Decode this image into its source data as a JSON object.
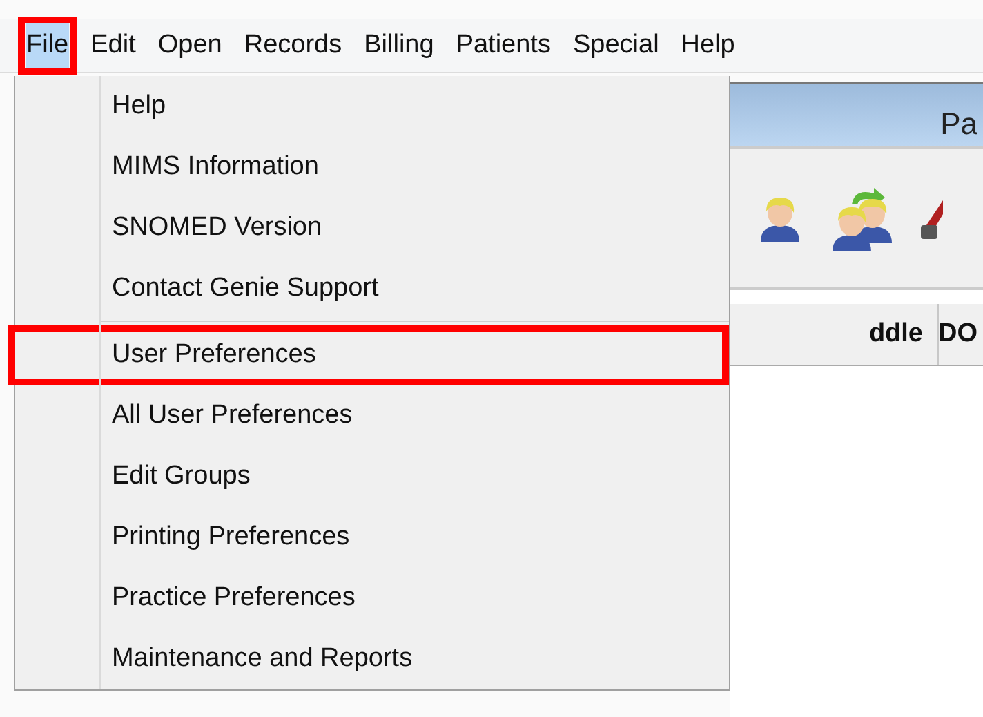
{
  "menu_bar": [
    {
      "label": "File",
      "selected": true,
      "annotated": true
    },
    {
      "label": "Edit",
      "selected": false,
      "annotated": false
    },
    {
      "label": "Open",
      "selected": false,
      "annotated": false
    },
    {
      "label": "Records",
      "selected": false,
      "annotated": false
    },
    {
      "label": "Billing",
      "selected": false,
      "annotated": false
    },
    {
      "label": "Patients",
      "selected": false,
      "annotated": false
    },
    {
      "label": "Special",
      "selected": false,
      "annotated": false
    },
    {
      "label": "Help",
      "selected": false,
      "annotated": false
    }
  ],
  "file_menu": [
    {
      "kind": "item",
      "label": "Help",
      "annotated": false
    },
    {
      "kind": "item",
      "label": "MIMS Information",
      "annotated": false
    },
    {
      "kind": "item",
      "label": "SNOMED Version",
      "annotated": false
    },
    {
      "kind": "item",
      "label": "Contact Genie Support",
      "annotated": false
    },
    {
      "kind": "separator"
    },
    {
      "kind": "item",
      "label": "User Preferences",
      "annotated": true
    },
    {
      "kind": "item",
      "label": "All User Preferences",
      "annotated": false
    },
    {
      "kind": "item",
      "label": "Edit Groups",
      "annotated": false
    },
    {
      "kind": "item",
      "label": "Printing Preferences",
      "annotated": false
    },
    {
      "kind": "item",
      "label": "Practice Preferences",
      "annotated": false
    },
    {
      "kind": "item",
      "label": "Maintenance and Reports",
      "annotated": false
    }
  ],
  "background_window": {
    "title": "Pa",
    "columns": [
      "ddle",
      "DO"
    ]
  }
}
